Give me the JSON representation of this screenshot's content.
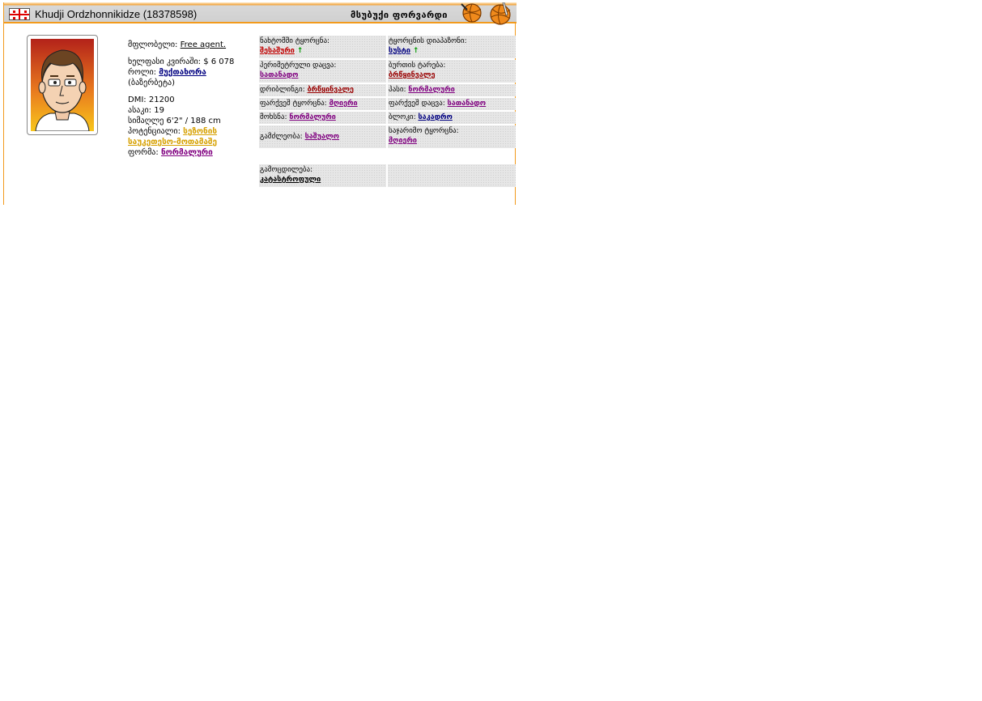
{
  "header": {
    "player_name": "Khudji Ordzhonnikidze (18378598)",
    "position": "მსუბუქი ფორვარდი",
    "flag_icon": "georgia-flag-icon",
    "ball_icons": [
      "basketball-icon",
      "basketball-icon"
    ]
  },
  "info": {
    "owner_label": "მფლობელი:",
    "owner_value": "Free agent.",
    "salary_label": "ხელფასი კვირაში:",
    "salary_value": "$ 6 078",
    "role_label": "როლი:",
    "role_value": "მუქთახორა",
    "role_note": "(ბაზერბეტა)",
    "dmi_label": "DMI:",
    "dmi_value": "21200",
    "age_label": "ასაკი:",
    "age_value": "19",
    "height_label": "სიმაღლე",
    "height_value": "6'2\" / 188 cm",
    "potential_label": "პოტენციალი:",
    "potential_value": "სეზონის საუკეთესო-მოთამაშე",
    "form_label": "ფორმა:",
    "form_value": "ნორმალური"
  },
  "skills": [
    {
      "label": "ნახტომში ტყორცნა:",
      "value": "შესაშური",
      "arrow": "↑",
      "color": "#c00000"
    },
    {
      "label": "ტყორცნის დიაპაზონი:",
      "value": "სუსტი",
      "arrow": "↑",
      "color": "#000080"
    },
    {
      "label": "პერიმეტრული დაცვა:",
      "value": "სათანადო",
      "arrow": "",
      "color": "#800080"
    },
    {
      "label": "ბურთის ტარება:",
      "value": "ბრწყინვალე",
      "arrow": "",
      "color": "#990000"
    },
    {
      "label": "დრიბლინგი:",
      "value": "ბრწყინვალე",
      "arrow": "",
      "color": "#990000"
    },
    {
      "label": "პასი:",
      "value": "ნორმალური",
      "arrow": "",
      "color": "#800080"
    },
    {
      "label": "ფარქვეშ ტყორცნა:",
      "value": "მღიერი",
      "arrow": "",
      "color": "#800080"
    },
    {
      "label": "ფარქვეშ დაცვა:",
      "value": "სათანადო",
      "arrow": "",
      "color": "#800080"
    },
    {
      "label": "მოხსნა:",
      "value": "ნორმალური",
      "arrow": "",
      "color": "#800080"
    },
    {
      "label": "ბლოკი:",
      "value": "საკადრო",
      "arrow": "",
      "color": "#000080"
    },
    {
      "label": "გამძლეობა:",
      "value": "საშუალო",
      "arrow": "",
      "color": "#800080"
    },
    {
      "label": "საჯარიმო ტყორცნა:",
      "value": "მღიერი",
      "arrow": "",
      "color": "#800080"
    }
  ],
  "experience": {
    "label": "გამოცდილება:",
    "value": "კატასტროფული",
    "color": "#000000"
  }
}
